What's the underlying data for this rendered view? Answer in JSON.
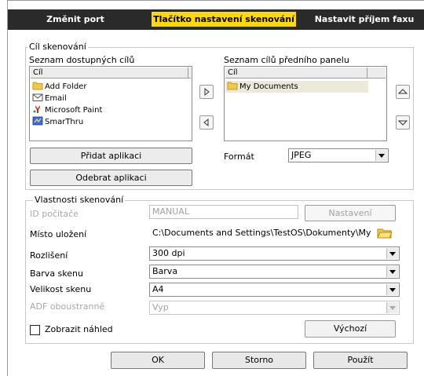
{
  "tabs": [
    {
      "label": "Změnit port"
    },
    {
      "label": "Tlačítko nastavení skenování"
    },
    {
      "label": "Nastavit příjem faxu"
    }
  ],
  "destination": {
    "group_label": "Cíl skenování",
    "available": {
      "label": "Seznam dostupných cílů",
      "column": "Cíl",
      "items": [
        {
          "label": "Add Folder",
          "icon": "folder-icon"
        },
        {
          "label": "Email",
          "icon": "envelope-icon"
        },
        {
          "label": "Microsoft Paint",
          "icon": "paint-icon"
        },
        {
          "label": "SmarThru",
          "icon": "smarthru-icon"
        }
      ]
    },
    "front_panel": {
      "label": "Seznam cílů předního panelu",
      "column": "Cíl",
      "items": [
        {
          "label": "My Documents",
          "icon": "folder-icon",
          "selected": true
        }
      ]
    },
    "add_app_label": "Přidat aplikaci",
    "remove_app_label": "Odebrat aplikaci",
    "format_label": "Formát",
    "format_value": "JPEG"
  },
  "properties": {
    "group_label": "Vlastnosti skenování",
    "pc_id_label": "ID počítače",
    "pc_id_value": "MANUAL",
    "settings_label": "Nastavení",
    "location_label": "Místo uložení",
    "location_value": "C:\\Documents and Settings\\TestOS\\Dokumenty\\My Pict",
    "resolution_label": "Rozlišení",
    "resolution_value": "300 dpi",
    "color_label": "Barva skenu",
    "color_value": "Barva",
    "size_label": "Velikost skenu",
    "size_value": "A4",
    "adf_label": "ADF oboustranně",
    "adf_value": "Vyp",
    "preview_label": "Zobrazit náhled",
    "preview_checked": false,
    "default_label": "Výchozí"
  },
  "footer": {
    "ok_label": "OK",
    "cancel_label": "Storno",
    "apply_label": "Použít"
  },
  "colors": {
    "tab_bar": "#2a2a2a",
    "active_tab": "#ffd900",
    "selection": "#ece9d8",
    "folder": "#f5c842"
  }
}
